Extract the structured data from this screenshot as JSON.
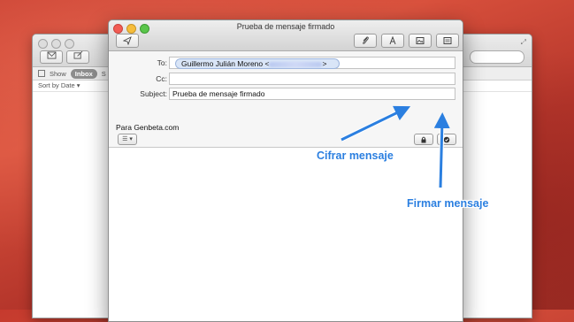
{
  "mail_viewer": {
    "filter_show": "Show",
    "filter_inbox": "Inbox",
    "filter_extra": "S",
    "sort_label": "Sort by Date ▾"
  },
  "compose": {
    "window_title": "Prueba de mensaje firmado",
    "fields": {
      "to_label": "To:",
      "to_token_name": "Guillermo Julián Moreno <",
      "to_token_end": ">",
      "cc_label": "Cc:",
      "cc_value": "",
      "subject_label": "Subject:",
      "subject_value": "Prueba de mensaje firmado"
    },
    "format_button": "☰ ▾",
    "body_text": "Para Genbeta.com"
  },
  "annotations": {
    "encrypt_label": "Cifrar mensaje",
    "sign_label": "Firmar mensaje",
    "color": "#2b7fe0"
  },
  "icons": {
    "send": "paper-plane-icon",
    "attach": "paperclip-icon",
    "fonts": "font-icon",
    "photo_browser": "photo-icon",
    "format_bar": "format-bar-icon",
    "encrypt": "lock-icon",
    "sign": "checkmark-seal-icon"
  }
}
